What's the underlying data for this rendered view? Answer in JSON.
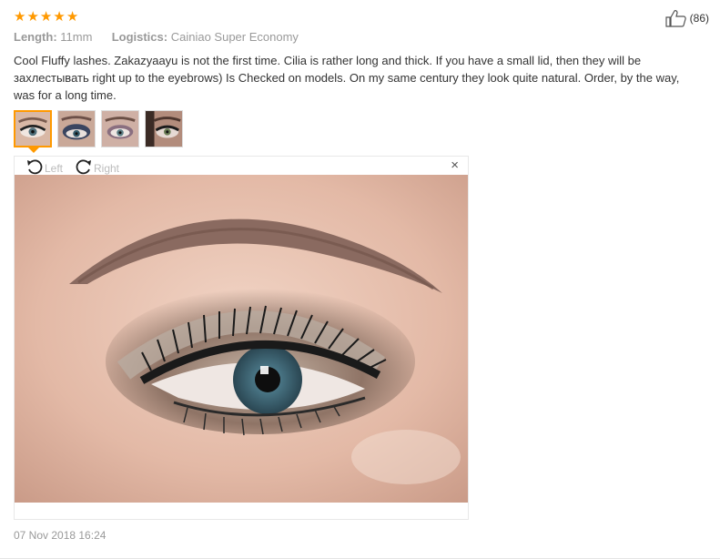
{
  "rating": {
    "stars": 5,
    "max": 5
  },
  "helpful": {
    "count_text": "(86)"
  },
  "meta": {
    "length_label": "Length:",
    "length_value": "11mm",
    "logistics_label": "Logistics:",
    "logistics_value": "Cainiao Super Economy"
  },
  "review": {
    "text": "Cool Fluffy lashes. Zakazyaayu is not the first time. Cilia is rather long and thick. If you have a small lid, then they will be захлестывать right up to the eyebrows) Is Checked on models. On my same century they look quite natural. Order, by the way, was for a long time."
  },
  "thumbnails": [
    {
      "selected": true
    },
    {
      "selected": false
    },
    {
      "selected": false
    },
    {
      "selected": false
    }
  ],
  "viewer": {
    "rotate_left_label": "Left",
    "rotate_right_label": "Right",
    "close_symbol": "×"
  },
  "date": "07 Nov 2018 16:24",
  "colors": {
    "accent": "#ff9900",
    "muted_text": "#999999",
    "body_text": "#333333"
  }
}
